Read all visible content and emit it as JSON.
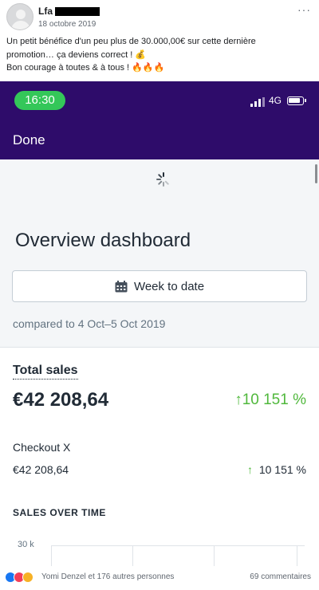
{
  "post": {
    "author": "Lfa",
    "date": "18 octobre 2019",
    "more_icon": "ellipsis-icon",
    "line1": "Un petit bénéfice d'un peu plus de 30.000,00€ sur cette dernière",
    "line2": "promotion… ça deviens correct ! 💰",
    "line3": "Bon courage à toutes & à tous ! 🔥🔥🔥"
  },
  "phone": {
    "time": "16:30",
    "network": "4G",
    "done_label": "Done"
  },
  "dashboard": {
    "title": "Overview dashboard",
    "date_range_label": "Week to date",
    "compared_label": "compared to 4 Oct–5 Oct 2019"
  },
  "total_sales": {
    "title": "Total sales",
    "value": "€42 208,64",
    "change": "10 151 %",
    "arrow": "↑"
  },
  "checkout": {
    "name": "Checkout X",
    "value": "€42 208,64",
    "change": "10 151 %",
    "arrow": "↑"
  },
  "sales_over_time": {
    "heading": "SALES OVER TIME",
    "y_tick": "30 k"
  },
  "footer": {
    "reactions_text": "Yomi Denzel et 176 autres personnes",
    "comments_text": "69 commentaires"
  },
  "colors": {
    "app_bar": "#2e0c6a",
    "positive": "#50b83c",
    "time_pill": "#34c759"
  }
}
